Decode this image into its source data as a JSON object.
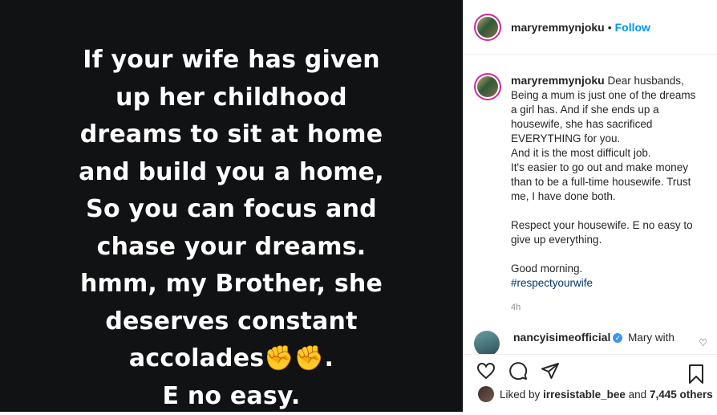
{
  "post": {
    "quote_lines": [
      "If your wife has given",
      "up her childhood",
      "dreams to sit at home",
      "and build you a home,",
      "So you can focus and",
      "chase your dreams.",
      "hmm, my Brother, she",
      "deserves constant",
      "accolades",
      "E no easy."
    ],
    "emoji": "✊",
    "accolades_suffix": "."
  },
  "header": {
    "username": "maryremmynjoku",
    "separator": "•",
    "follow_label": "Follow"
  },
  "caption": {
    "username": "maryremmynjoku",
    "paragraph1_lines": [
      "Dear husbands,",
      "Being a mum is just one of the dreams a girl has. And if she ends up a housewife, she has sacrificed EVERYTHING for you.",
      "And it is the most difficult job.",
      "It's easier to go out and make money than to be a full-time housewife. Trust me, I have done both."
    ],
    "paragraph2": "Respect your housewife. E no easy to give up everything.",
    "paragraph3": "Good morning.",
    "hashtag": "#respectyourwife",
    "time": "4h"
  },
  "comment": {
    "username": "nancyisimeofficial",
    "text": "Mary with"
  },
  "likes": {
    "prefix": "Liked by",
    "user": "irresistable_bee",
    "middle": "and",
    "count": "7,445 others"
  },
  "icons": {
    "like": "heart-icon",
    "comment": "comment-icon",
    "share": "share-icon",
    "save": "bookmark-icon"
  }
}
